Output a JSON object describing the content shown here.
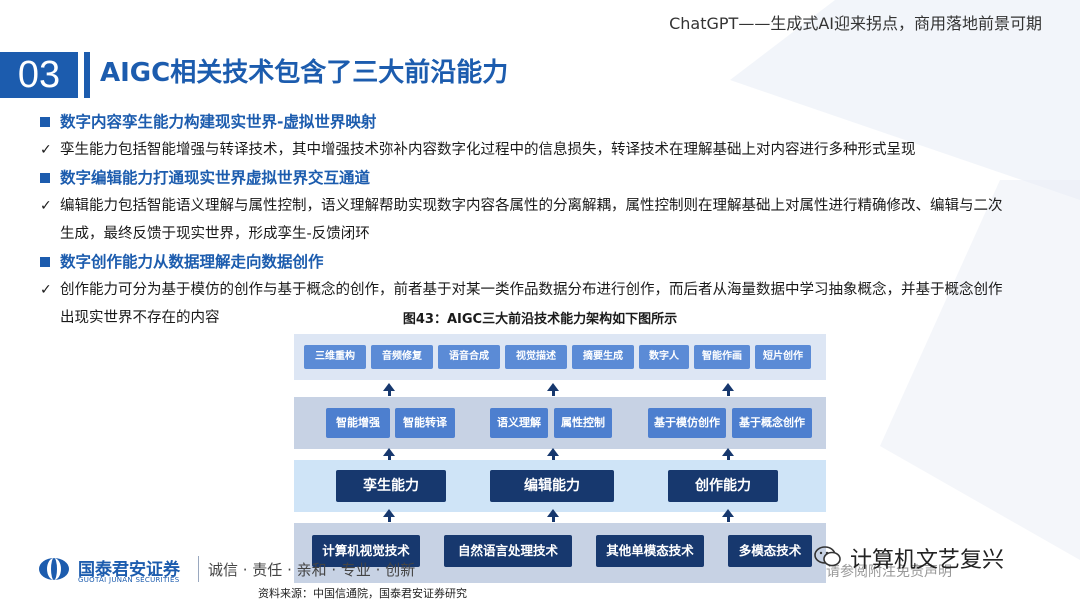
{
  "header": {
    "title": "ChatGPT——生成式AI迎来拐点，商用落地前景可期"
  },
  "section": {
    "number": "03",
    "title": "AIGC相关技术包含了三大前沿能力"
  },
  "content": {
    "h1": "数字内容孪生能力构建现实世界-虚拟世界映射",
    "p1": "孪生能力包括智能增强与转译技术，其中增强技术弥补内容数字化过程中的信息损失，转译技术在理解基础上对内容进行多种形式呈现",
    "h2": "数字编辑能力打通现实世界虚拟世界交互通道",
    "p2a": "编辑能力包括智能语义理解与属性控制，语义理解帮助实现数字内容各属性的分离解耦，属性控制则在理解基础上对属性进行精确修改、编辑与二次",
    "p2b": "生成，最终反馈于现实世界，形成孪生-反馈闭环",
    "h3": "数字创作能力从数据理解走向数据创作",
    "p3a": "创作能力可分为基于模仿的创作与基于概念的创作，前者基于对某一类作品数据分布进行创作，而后者从海量数据中学习抽象概念，并基于概念创作",
    "p3b": "出现实世界不存在的内容",
    "check": "✓"
  },
  "figure": {
    "caption": "图43：AIGC三大前沿技术能力架构如下图所示",
    "applications": [
      "三维重构",
      "音频修复",
      "语音合成",
      "视觉描述",
      "摘要生成",
      "数字人",
      "智能作画",
      "短片创作"
    ],
    "techniques": [
      "智能增强",
      "智能转译",
      "语义理解",
      "属性控制",
      "基于模仿创作",
      "基于概念创作"
    ],
    "capabilities": [
      "孪生能力",
      "编辑能力",
      "创作能力"
    ],
    "foundations": [
      "计算机视觉技术",
      "自然语言处理技术",
      "其他单模态技术",
      "多模态技术"
    ]
  },
  "footer": {
    "logo_cn": "国泰君安证券",
    "logo_en": "GUOTAI JUNAN SECURITIES",
    "slogan": "诚信 · 责任 · 亲和 · 专业 · 创新",
    "right_text": "请参阅附注免责声明",
    "watermark": "计算机文艺复兴",
    "source": "资料来源：中国信通院，国泰君安证券研究"
  }
}
